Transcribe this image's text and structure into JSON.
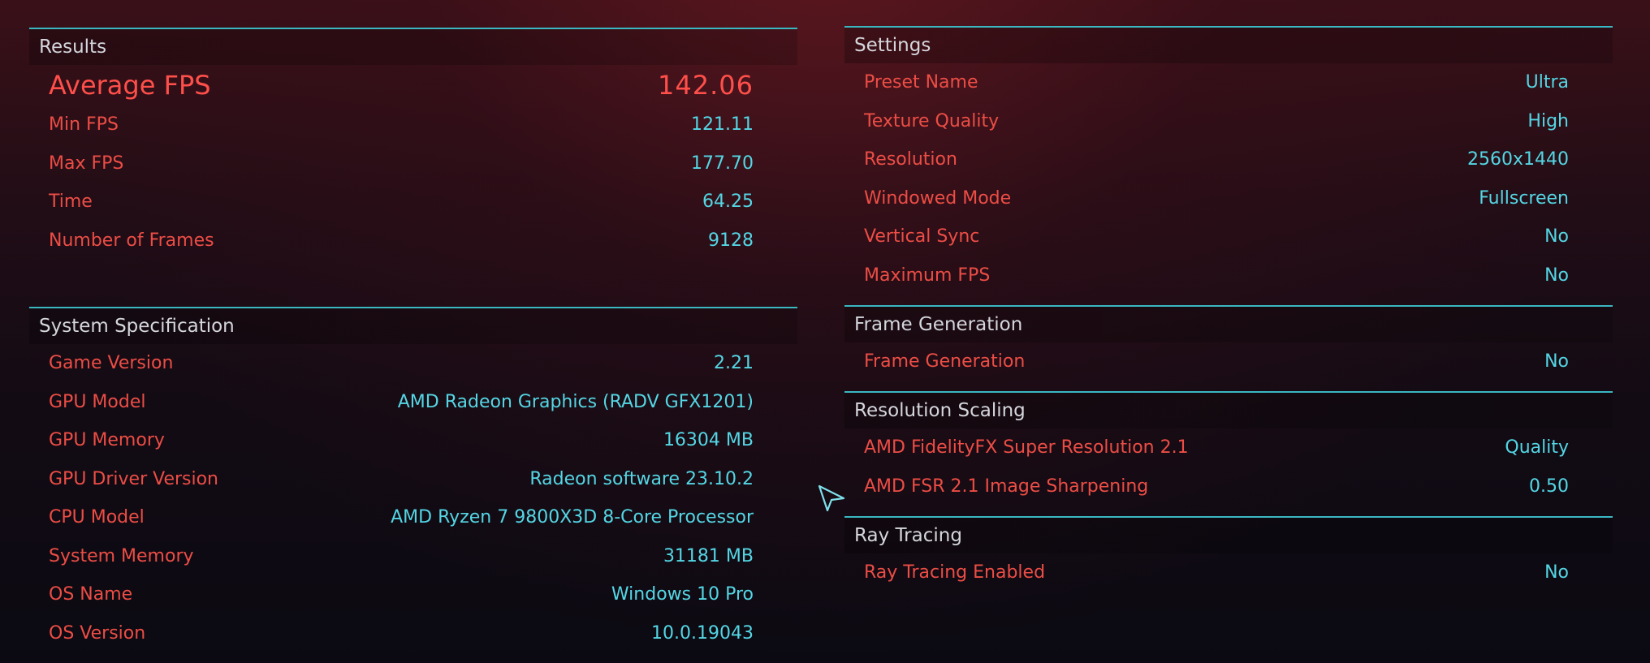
{
  "results": {
    "title": "Results",
    "average": {
      "label": "Average FPS",
      "value": "142.06"
    },
    "rows": [
      {
        "label": "Min FPS",
        "value": "121.11"
      },
      {
        "label": "Max FPS",
        "value": "177.70"
      },
      {
        "label": "Time",
        "value": "64.25"
      },
      {
        "label": "Number of Frames",
        "value": "9128"
      }
    ]
  },
  "system_spec": {
    "title": "System Specification",
    "rows": [
      {
        "label": "Game Version",
        "value": "2.21"
      },
      {
        "label": "GPU Model",
        "value": "AMD Radeon Graphics (RADV GFX1201)"
      },
      {
        "label": "GPU Memory",
        "value": "16304 MB"
      },
      {
        "label": "GPU Driver Version",
        "value": "Radeon software 23.10.2"
      },
      {
        "label": "CPU Model",
        "value": "AMD Ryzen 7 9800X3D 8-Core Processor"
      },
      {
        "label": "System Memory",
        "value": "31181 MB"
      },
      {
        "label": "OS Name",
        "value": "Windows 10 Pro"
      },
      {
        "label": "OS Version",
        "value": "10.0.19043"
      }
    ]
  },
  "settings": {
    "title": "Settings",
    "rows": [
      {
        "label": "Preset Name",
        "value": "Ultra"
      },
      {
        "label": "Texture Quality",
        "value": "High"
      },
      {
        "label": "Resolution",
        "value": "2560x1440"
      },
      {
        "label": "Windowed Mode",
        "value": "Fullscreen"
      },
      {
        "label": "Vertical Sync",
        "value": "No"
      },
      {
        "label": "Maximum FPS",
        "value": "No"
      }
    ]
  },
  "frame_generation": {
    "title": "Frame Generation",
    "rows": [
      {
        "label": "Frame Generation",
        "value": "No"
      }
    ]
  },
  "resolution_scaling": {
    "title": "Resolution Scaling",
    "rows": [
      {
        "label": "AMD FidelityFX Super Resolution 2.1",
        "value": "Quality"
      },
      {
        "label": "AMD FSR 2.1 Image Sharpening",
        "value": "0.50"
      }
    ]
  },
  "ray_tracing": {
    "title": "Ray Tracing",
    "rows": [
      {
        "label": "Ray Tracing Enabled",
        "value": "No"
      }
    ]
  },
  "colors": {
    "accent_line": "#3ab8c2",
    "label_red": "#ec4d45",
    "value_cyan": "#54d6e4",
    "header_text": "#d4d6dc"
  },
  "icons": {
    "cursor": "arrow-cursor-icon"
  }
}
